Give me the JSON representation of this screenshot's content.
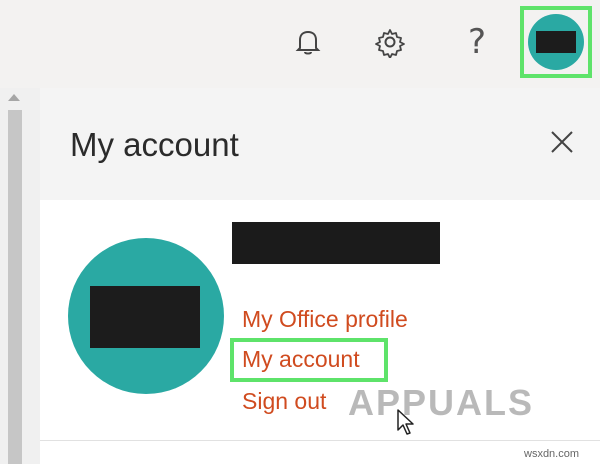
{
  "topbar": {
    "help_glyph": "?",
    "icons": [
      "bell-icon",
      "gear-icon",
      "help-icon",
      "avatar"
    ]
  },
  "panel": {
    "title": "My account",
    "links": {
      "office_profile": "My Office profile",
      "my_account": "My account",
      "sign_out": "Sign out"
    }
  },
  "watermark": "APPUALS",
  "site": "wsxdn.com",
  "colors": {
    "avatar_teal": "#2aa9a3",
    "link_orange": "#d04b1f",
    "highlight_green": "#5ee36a"
  }
}
